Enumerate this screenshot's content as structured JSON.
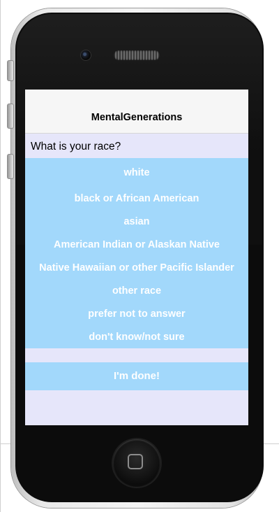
{
  "app": {
    "title": "MentalGenerations"
  },
  "survey": {
    "question": "What is your race?",
    "options": [
      "white",
      "black or African American",
      "asian",
      "American Indian or Alaskan Native",
      "Native Hawaiian or other Pacific Islander",
      "other race",
      "prefer not to answer",
      "don't know/not sure"
    ],
    "done_label": "I'm done!"
  },
  "colors": {
    "screen_background": "#e6e6fa",
    "option_background": "#a2d8fb",
    "option_text": "#ffffff",
    "navbar_background": "#f6f6f6"
  },
  "icons": {
    "home_button": "home-button-icon",
    "camera": "camera-icon",
    "speaker": "speaker-grille-icon"
  }
}
